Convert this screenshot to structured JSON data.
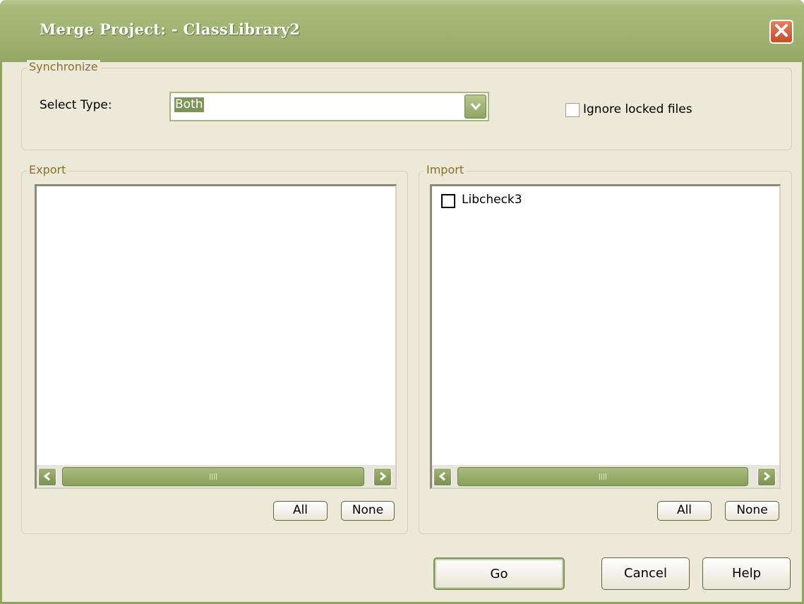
{
  "window": {
    "title": "Merge Project: - ClassLibrary2"
  },
  "synchronize": {
    "legend": "Synchronize",
    "select_type_label": "Select Type:",
    "select_type_value": "Both",
    "ignore_locked_label": "Ignore locked files",
    "ignore_locked_checked": false
  },
  "export": {
    "legend": "Export",
    "items": [],
    "all_label": "All",
    "none_label": "None"
  },
  "import": {
    "legend": "Import",
    "items": [
      {
        "label": "Libcheck3",
        "checked": false
      }
    ],
    "all_label": "All",
    "none_label": "None"
  },
  "buttons": {
    "go": "Go",
    "cancel": "Cancel",
    "help": "Help"
  },
  "icons": {
    "close": "close-icon",
    "dropdown": "chevron-down-icon",
    "scroll_left": "arrow-left-icon",
    "scroll_right": "arrow-right-icon"
  },
  "colors": {
    "titlebar": "#a0b474",
    "dialog_bg": "#ece9d8",
    "group_label": "#8a6e2c",
    "selection": "#7f9459"
  }
}
